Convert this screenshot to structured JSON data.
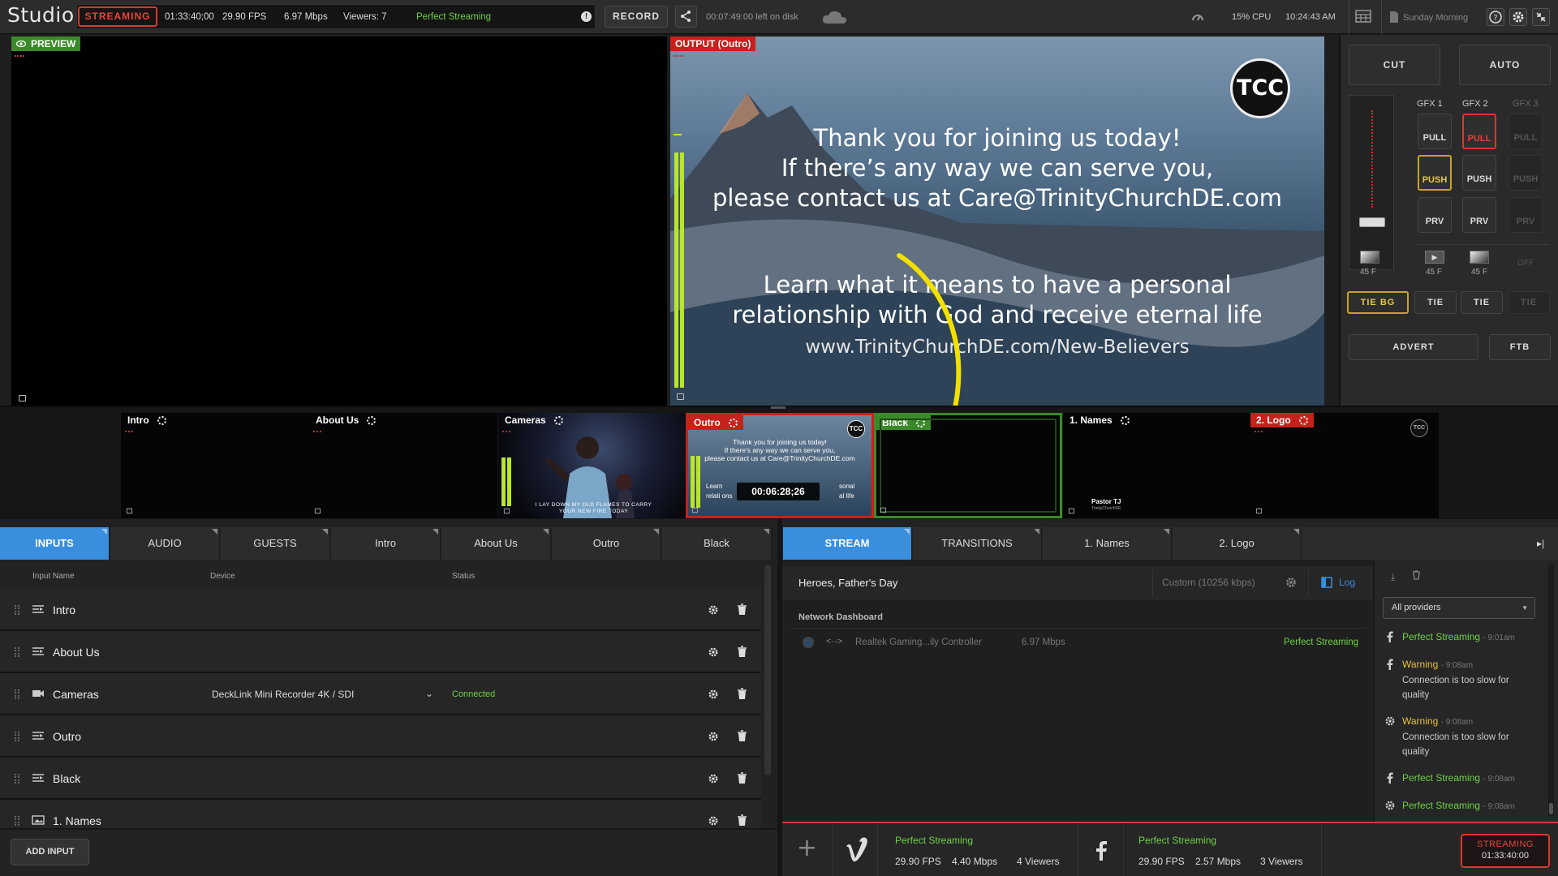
{
  "app": {
    "title": "Studio",
    "streaming_label": "STREAMING",
    "time": "01:33:40;00",
    "fps": "29.90 FPS",
    "bitrate": "6.97 Mbps",
    "viewers": "Viewers: 7",
    "stream_status": "Perfect Streaming",
    "record_label": "RECORD",
    "disk_left": "00:07:49:00 left on disk",
    "cpu": "15% CPU",
    "clock": "10:24:43 AM",
    "show_name": "Sunday Morning"
  },
  "preview": {
    "label": "PREVIEW"
  },
  "output": {
    "label": "OUTPUT (Outro)",
    "logo": "TCC",
    "line1": "Thank you for joining us today!",
    "line2": "If there’s any way we can serve you,",
    "line3": "please contact us at Care@TrinityChurchDE.com",
    "line4": "Learn what it means to have a personal",
    "line5": "relationship with God and receive eternal life",
    "line6": "www.TrinityChurchDE.com/New-Believers"
  },
  "switcher": {
    "cut": "CUT",
    "auto": "AUTO",
    "gfx1": "GFX 1",
    "gfx2": "GFX 2",
    "gfx3": "GFX 3",
    "pull": "PULL",
    "push": "PUSH",
    "prv": "PRV",
    "frames": "45 F",
    "off": "OFF",
    "tie_bg": "TIE BG",
    "tie": "TIE",
    "advert": "ADVERT",
    "ftb": "FTB"
  },
  "tiles": [
    {
      "name": "Intro"
    },
    {
      "name": "About Us"
    },
    {
      "name": "Cameras",
      "caption": "I LAY DOWN MY OLD FLAMES TO CARRY YOUR NEW FIRE TODAY"
    },
    {
      "name": "Outro",
      "timer": "00:06:28;26",
      "mini1": "Thank you for joining us today!",
      "mini2": "If there's any way we can serve you,",
      "mini3": "please contact us at Care@TrinityChurchDE.com",
      "mini4": "Learn",
      "mini5": "relati ons",
      "mini6": "sonal",
      "mini7": "al life",
      "logo": "TCC"
    },
    {
      "name": "Black"
    },
    {
      "name": "1. Names",
      "lower": "Pastor TJ",
      "lower_sub": "TrinityChurchDE"
    },
    {
      "name": "2. Logo",
      "logo": "TCC"
    }
  ],
  "left_tabs": [
    "INPUTS",
    "AUDIO",
    "GUESTS",
    "Intro",
    "About Us",
    "Outro",
    "Black"
  ],
  "inputs_header": {
    "name": "Input Name",
    "device": "Device",
    "status": "Status"
  },
  "inputs": [
    {
      "name": "Intro",
      "device": "",
      "status": ""
    },
    {
      "name": "About Us",
      "device": "",
      "status": ""
    },
    {
      "name": "Cameras",
      "device": "DeckLink Mini Recorder 4K / SDI",
      "status": "Connected"
    },
    {
      "name": "Outro",
      "device": "",
      "status": ""
    },
    {
      "name": "Black",
      "device": "",
      "status": ""
    },
    {
      "name": "1. Names",
      "device": "",
      "status": ""
    }
  ],
  "add_input": "ADD INPUT",
  "right_tabs": [
    "STREAM",
    "TRANSITIONS",
    "1. Names",
    "2. Logo"
  ],
  "stream": {
    "title": "Heroes, Father's Day",
    "custom": "Custom (10256 kbps)",
    "log": "Log",
    "dashboard": "Network Dashboard",
    "adapter": "Realtek Gaming...ily Controller",
    "adapter_rate": "6.97 Mbps",
    "adapter_status": "Perfect Streaming"
  },
  "log": {
    "filter": "All providers",
    "entries": [
      {
        "source": "facebook",
        "status": "Perfect Streaming",
        "time": "- 9:01am",
        "msg": ""
      },
      {
        "source": "facebook",
        "status": "Warning",
        "time": "- 9:08am",
        "msg": "Connection is too slow for quality"
      },
      {
        "source": "gear",
        "status": "Warning",
        "time": "- 9:08am",
        "msg": "Connection is too slow for quality"
      },
      {
        "source": "facebook",
        "status": "Perfect Streaming",
        "time": "- 9:08am",
        "msg": ""
      },
      {
        "source": "gear",
        "status": "Perfect Streaming",
        "time": "- 9:08am",
        "msg": ""
      }
    ]
  },
  "destinations": [
    {
      "service": "vimeo",
      "status": "Perfect Streaming",
      "fps": "29.90 FPS",
      "rate": "4.40 Mbps",
      "viewers": "4 Viewers"
    },
    {
      "service": "facebook",
      "status": "Perfect Streaming",
      "fps": "29.90 FPS",
      "rate": "2.57 Mbps",
      "viewers": "3 Viewers"
    }
  ],
  "stream_btn": {
    "label": "STREAMING",
    "time": "01:33:40:00"
  },
  "colors": {
    "accent": "#3a8ede",
    "live": "#d23b2f",
    "ok": "#6ed345",
    "warn": "#e8c23a",
    "tie": "#c9a32a"
  }
}
